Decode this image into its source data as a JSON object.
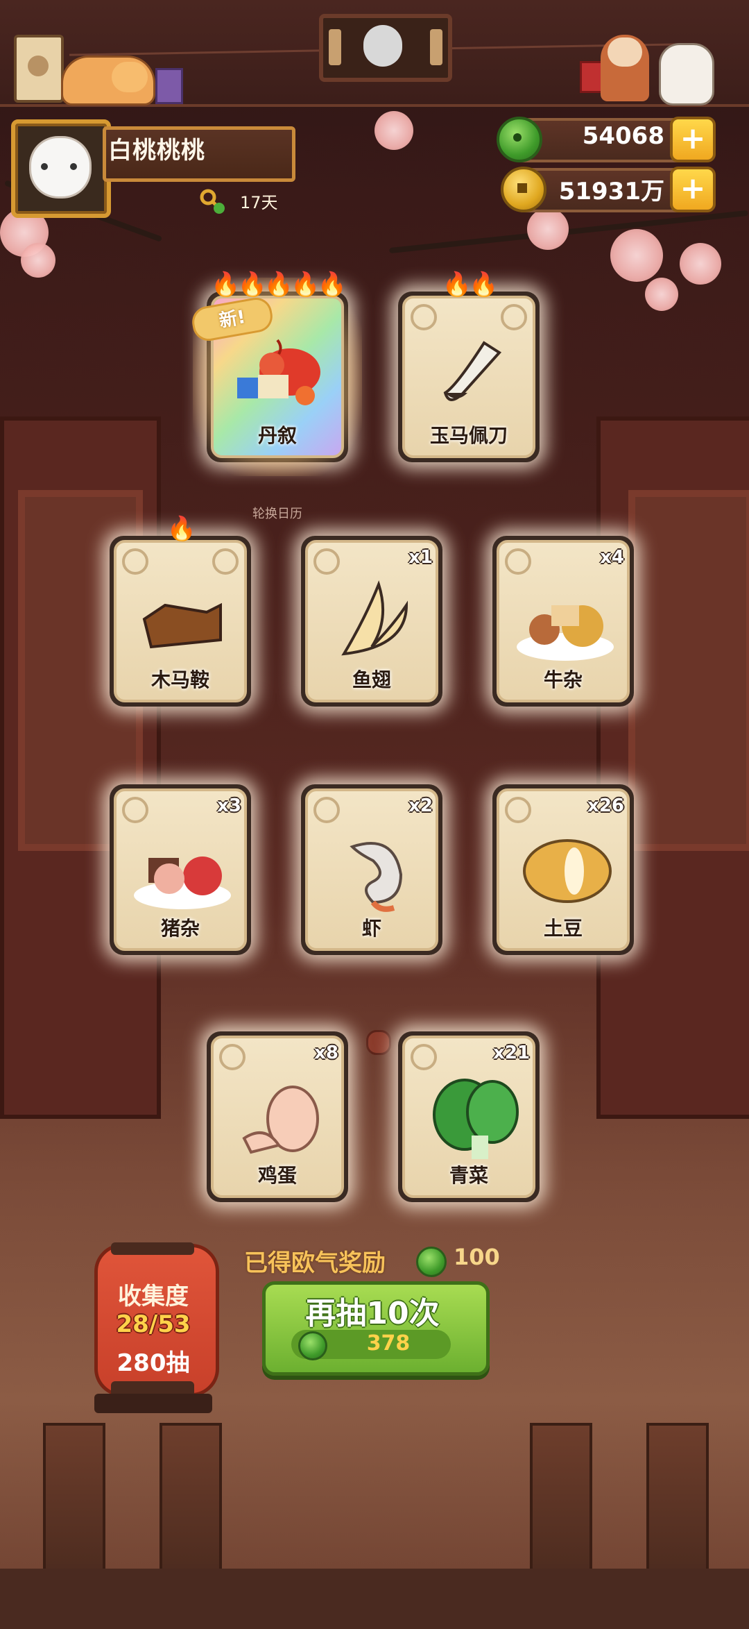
{
  "profile": {
    "name": "白桃桃桃",
    "days": "17天"
  },
  "currency": {
    "jade": {
      "value": "54068",
      "icon": "jade-icon"
    },
    "coins": {
      "value": "51931万",
      "icon": "coin-icon"
    },
    "plus_symbol": "+"
  },
  "cards": [
    {
      "id": "danxu",
      "name": "丹叙",
      "count": "",
      "flames": "🔥🔥🔥🔥🔥",
      "is_new": true,
      "new_label": "新!"
    },
    {
      "id": "jade-knife",
      "name": "玉马佩刀",
      "count": "",
      "flames": "🔥🔥",
      "is_new": false
    },
    {
      "id": "saddle",
      "name": "木马鞍",
      "count": "",
      "flames": "🔥",
      "is_new": false
    },
    {
      "id": "shark-fin",
      "name": "鱼翅",
      "count": "x1",
      "flames": "",
      "is_new": false
    },
    {
      "id": "beef-offal",
      "name": "牛杂",
      "count": "x4",
      "flames": "",
      "is_new": false
    },
    {
      "id": "pork-offal",
      "name": "猪杂",
      "count": "x3",
      "flames": "",
      "is_new": false
    },
    {
      "id": "shrimp",
      "name": "虾",
      "count": "x2",
      "flames": "",
      "is_new": false
    },
    {
      "id": "potato",
      "name": "土豆",
      "count": "x26",
      "flames": "",
      "is_new": false
    },
    {
      "id": "egg",
      "name": "鸡蛋",
      "count": "x8",
      "flames": "",
      "is_new": false
    },
    {
      "id": "greens",
      "name": "青菜",
      "count": "x21",
      "flames": "",
      "is_new": false
    }
  ],
  "calendar_label": "轮换日历",
  "reward": {
    "label": "已得欧气奖励",
    "value": "100"
  },
  "collection": {
    "title": "收集度",
    "progress": "28/53",
    "pulls": "280抽"
  },
  "draw_button": {
    "label": "再抽10次",
    "cost": "378"
  },
  "colors": {
    "accent_gold": "#d79a32",
    "button_green": "#6cb030",
    "reward_gold": "#f7c25a"
  }
}
